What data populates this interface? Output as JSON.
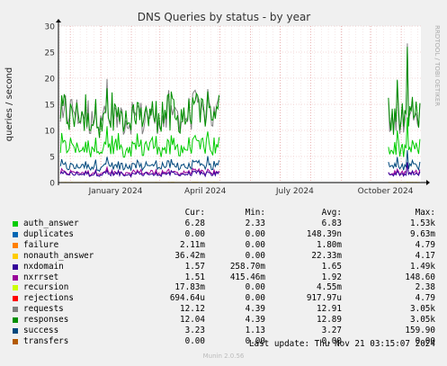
{
  "chart_data": {
    "type": "line",
    "title": "DNS Queries by status - by year",
    "ylabel": "queries / second",
    "side_label": "RRDTOOL / TOBI OETIKER",
    "ylim": [
      0,
      30
    ],
    "yticks": [
      0,
      5,
      10,
      15,
      20,
      25,
      30
    ],
    "xticks": [
      "January 2024",
      "April 2024",
      "July 2024",
      "October 2024"
    ],
    "x_start": "2023-11-19",
    "x_end": "2024-11-21",
    "grid": true,
    "data_segments": [
      [
        "2023-11-21",
        "2024-05-01"
      ],
      [
        "2024-10-19",
        "2024-11-21"
      ]
    ],
    "series": [
      {
        "name": "auth_answer",
        "color": "#00cc00",
        "mean": 6.83,
        "min": 2.33,
        "peak": 12.5
      },
      {
        "name": "duplicates",
        "color": "#0066b3",
        "mean": 0.000148,
        "min": 0,
        "peak": 0.01
      },
      {
        "name": "failure",
        "color": "#ff8000",
        "mean": 0.0018,
        "min": 0,
        "peak": 0.02
      },
      {
        "name": "nonauth_answer",
        "color": "#ffcc00",
        "mean": 0.022,
        "min": 0,
        "peak": 0.05
      },
      {
        "name": "nxdomain",
        "color": "#330099",
        "mean": 1.65,
        "min": 0.26,
        "peak": 5.8
      },
      {
        "name": "nxrrset",
        "color": "#990099",
        "mean": 1.92,
        "min": 0.42,
        "peak": 3.8
      },
      {
        "name": "recursion",
        "color": "#ccff00",
        "mean": 0.0046,
        "min": 0,
        "peak": 0.02
      },
      {
        "name": "rejections",
        "color": "#ff0000",
        "mean": 0.00092,
        "min": 0,
        "peak": 0.01
      },
      {
        "name": "requests",
        "color": "#808080",
        "mean": 12.91,
        "min": 4.39,
        "peak": 27
      },
      {
        "name": "responses",
        "color": "#008f00",
        "mean": 12.89,
        "min": 4.39,
        "peak": 27
      },
      {
        "name": "success",
        "color": "#00487d",
        "mean": 3.27,
        "min": 1.13,
        "peak": 6.2
      },
      {
        "name": "transfers",
        "color": "#b35a00",
        "mean": 0,
        "min": 0,
        "peak": 0
      }
    ]
  },
  "legend": {
    "headers": {
      "cur": "Cur:",
      "min": "Min:",
      "avg": "Avg:",
      "max": "Max:"
    },
    "rows": [
      {
        "name": "auth_answer",
        "color": "#00cc00",
        "cur": "6.28",
        "min": "2.33",
        "avg": "6.83",
        "max": "1.53k"
      },
      {
        "name": "duplicates",
        "color": "#0066b3",
        "cur": "0.00",
        "min": "0.00",
        "avg": "148.39n",
        "max": "9.63m"
      },
      {
        "name": "failure",
        "color": "#ff8000",
        "cur": "2.11m",
        "min": "0.00",
        "avg": "1.80m",
        "max": "4.79"
      },
      {
        "name": "nonauth_answer",
        "color": "#ffcc00",
        "cur": "36.42m",
        "min": "0.00",
        "avg": "22.33m",
        "max": "4.17"
      },
      {
        "name": "nxdomain",
        "color": "#330099",
        "cur": "1.57",
        "min": "258.70m",
        "avg": "1.65",
        "max": "1.49k"
      },
      {
        "name": "nxrrset",
        "color": "#990099",
        "cur": "1.51",
        "min": "415.46m",
        "avg": "1.92",
        "max": "148.60"
      },
      {
        "name": "recursion",
        "color": "#ccff00",
        "cur": "17.83m",
        "min": "0.00",
        "avg": "4.55m",
        "max": "2.38"
      },
      {
        "name": "rejections",
        "color": "#ff0000",
        "cur": "694.64u",
        "min": "0.00",
        "avg": "917.97u",
        "max": "4.79"
      },
      {
        "name": "requests",
        "color": "#808080",
        "cur": "12.12",
        "min": "4.39",
        "avg": "12.91",
        "max": "3.05k"
      },
      {
        "name": "responses",
        "color": "#008f00",
        "cur": "12.04",
        "min": "4.39",
        "avg": "12.89",
        "max": "3.05k"
      },
      {
        "name": "success",
        "color": "#00487d",
        "cur": "3.23",
        "min": "1.13",
        "avg": "3.27",
        "max": "159.90"
      },
      {
        "name": "transfers",
        "color": "#b35a00",
        "cur": "0.00",
        "min": "0.00",
        "avg": "0.00",
        "max": "0.00"
      }
    ]
  },
  "footer": {
    "last_update": "Last update: Thu Nov 21 03:15:07 2024",
    "munin": "Munin 2.0.56"
  }
}
